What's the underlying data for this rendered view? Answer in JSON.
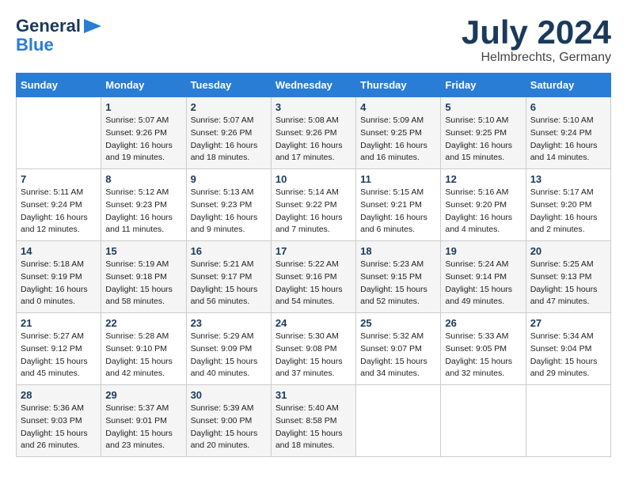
{
  "header": {
    "logo_line1": "General",
    "logo_line2": "Blue",
    "month": "July 2024",
    "location": "Helmbrechts, Germany"
  },
  "days_of_week": [
    "Sunday",
    "Monday",
    "Tuesday",
    "Wednesday",
    "Thursday",
    "Friday",
    "Saturday"
  ],
  "weeks": [
    [
      {
        "day": "",
        "info": ""
      },
      {
        "day": "1",
        "info": "Sunrise: 5:07 AM\nSunset: 9:26 PM\nDaylight: 16 hours\nand 19 minutes."
      },
      {
        "day": "2",
        "info": "Sunrise: 5:07 AM\nSunset: 9:26 PM\nDaylight: 16 hours\nand 18 minutes."
      },
      {
        "day": "3",
        "info": "Sunrise: 5:08 AM\nSunset: 9:26 PM\nDaylight: 16 hours\nand 17 minutes."
      },
      {
        "day": "4",
        "info": "Sunrise: 5:09 AM\nSunset: 9:25 PM\nDaylight: 16 hours\nand 16 minutes."
      },
      {
        "day": "5",
        "info": "Sunrise: 5:10 AM\nSunset: 9:25 PM\nDaylight: 16 hours\nand 15 minutes."
      },
      {
        "day": "6",
        "info": "Sunrise: 5:10 AM\nSunset: 9:24 PM\nDaylight: 16 hours\nand 14 minutes."
      }
    ],
    [
      {
        "day": "7",
        "info": "Sunrise: 5:11 AM\nSunset: 9:24 PM\nDaylight: 16 hours\nand 12 minutes."
      },
      {
        "day": "8",
        "info": "Sunrise: 5:12 AM\nSunset: 9:23 PM\nDaylight: 16 hours\nand 11 minutes."
      },
      {
        "day": "9",
        "info": "Sunrise: 5:13 AM\nSunset: 9:23 PM\nDaylight: 16 hours\nand 9 minutes."
      },
      {
        "day": "10",
        "info": "Sunrise: 5:14 AM\nSunset: 9:22 PM\nDaylight: 16 hours\nand 7 minutes."
      },
      {
        "day": "11",
        "info": "Sunrise: 5:15 AM\nSunset: 9:21 PM\nDaylight: 16 hours\nand 6 minutes."
      },
      {
        "day": "12",
        "info": "Sunrise: 5:16 AM\nSunset: 9:20 PM\nDaylight: 16 hours\nand 4 minutes."
      },
      {
        "day": "13",
        "info": "Sunrise: 5:17 AM\nSunset: 9:20 PM\nDaylight: 16 hours\nand 2 minutes."
      }
    ],
    [
      {
        "day": "14",
        "info": "Sunrise: 5:18 AM\nSunset: 9:19 PM\nDaylight: 16 hours\nand 0 minutes."
      },
      {
        "day": "15",
        "info": "Sunrise: 5:19 AM\nSunset: 9:18 PM\nDaylight: 15 hours\nand 58 minutes."
      },
      {
        "day": "16",
        "info": "Sunrise: 5:21 AM\nSunset: 9:17 PM\nDaylight: 15 hours\nand 56 minutes."
      },
      {
        "day": "17",
        "info": "Sunrise: 5:22 AM\nSunset: 9:16 PM\nDaylight: 15 hours\nand 54 minutes."
      },
      {
        "day": "18",
        "info": "Sunrise: 5:23 AM\nSunset: 9:15 PM\nDaylight: 15 hours\nand 52 minutes."
      },
      {
        "day": "19",
        "info": "Sunrise: 5:24 AM\nSunset: 9:14 PM\nDaylight: 15 hours\nand 49 minutes."
      },
      {
        "day": "20",
        "info": "Sunrise: 5:25 AM\nSunset: 9:13 PM\nDaylight: 15 hours\nand 47 minutes."
      }
    ],
    [
      {
        "day": "21",
        "info": "Sunrise: 5:27 AM\nSunset: 9:12 PM\nDaylight: 15 hours\nand 45 minutes."
      },
      {
        "day": "22",
        "info": "Sunrise: 5:28 AM\nSunset: 9:10 PM\nDaylight: 15 hours\nand 42 minutes."
      },
      {
        "day": "23",
        "info": "Sunrise: 5:29 AM\nSunset: 9:09 PM\nDaylight: 15 hours\nand 40 minutes."
      },
      {
        "day": "24",
        "info": "Sunrise: 5:30 AM\nSunset: 9:08 PM\nDaylight: 15 hours\nand 37 minutes."
      },
      {
        "day": "25",
        "info": "Sunrise: 5:32 AM\nSunset: 9:07 PM\nDaylight: 15 hours\nand 34 minutes."
      },
      {
        "day": "26",
        "info": "Sunrise: 5:33 AM\nSunset: 9:05 PM\nDaylight: 15 hours\nand 32 minutes."
      },
      {
        "day": "27",
        "info": "Sunrise: 5:34 AM\nSunset: 9:04 PM\nDaylight: 15 hours\nand 29 minutes."
      }
    ],
    [
      {
        "day": "28",
        "info": "Sunrise: 5:36 AM\nSunset: 9:03 PM\nDaylight: 15 hours\nand 26 minutes."
      },
      {
        "day": "29",
        "info": "Sunrise: 5:37 AM\nSunset: 9:01 PM\nDaylight: 15 hours\nand 23 minutes."
      },
      {
        "day": "30",
        "info": "Sunrise: 5:39 AM\nSunset: 9:00 PM\nDaylight: 15 hours\nand 20 minutes."
      },
      {
        "day": "31",
        "info": "Sunrise: 5:40 AM\nSunset: 8:58 PM\nDaylight: 15 hours\nand 18 minutes."
      },
      {
        "day": "",
        "info": ""
      },
      {
        "day": "",
        "info": ""
      },
      {
        "day": "",
        "info": ""
      }
    ]
  ]
}
